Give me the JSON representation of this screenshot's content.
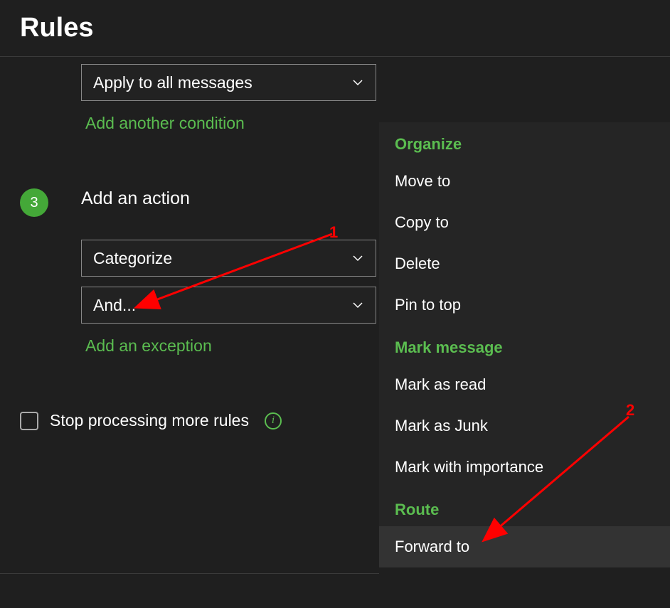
{
  "title": "Rules",
  "condition": {
    "selected": "Apply to all messages",
    "add_condition_link": "Add another condition"
  },
  "action_section": {
    "step_number": "3",
    "heading": "Add an action",
    "first_action": "Categorize",
    "second_action": "And...",
    "add_exception_link": "Add an exception"
  },
  "stop_processing": {
    "label": "Stop processing more rules"
  },
  "menu": {
    "groups": [
      {
        "title": "Organize",
        "items": [
          "Move to",
          "Copy to",
          "Delete",
          "Pin to top"
        ]
      },
      {
        "title": "Mark message",
        "items": [
          "Mark as read",
          "Mark as Junk",
          "Mark with importance"
        ]
      },
      {
        "title": "Route",
        "items": [
          "Forward to"
        ]
      }
    ]
  },
  "annotations": {
    "label1": "1",
    "label2": "2"
  }
}
